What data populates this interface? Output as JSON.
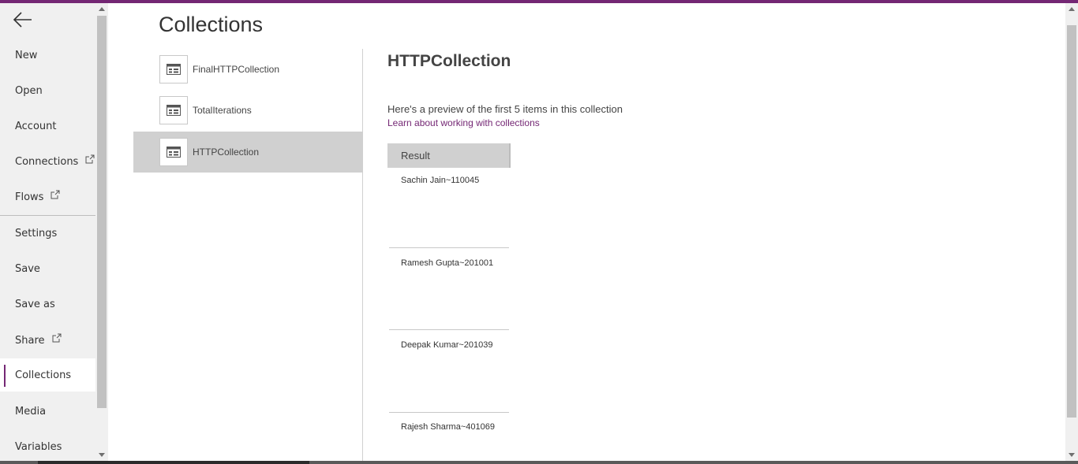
{
  "page": {
    "title": "Collections"
  },
  "sidebar": {
    "back_icon": "arrow-left-icon",
    "items": [
      {
        "label": "New",
        "external": false
      },
      {
        "label": "Open",
        "external": false
      },
      {
        "label": "Account",
        "external": false
      },
      {
        "label": "Connections",
        "external": true
      },
      {
        "label": "Flows",
        "external": true
      },
      {
        "label": "Settings",
        "external": false
      },
      {
        "label": "Save",
        "external": false
      },
      {
        "label": "Save as",
        "external": false
      },
      {
        "label": "Share",
        "external": true
      },
      {
        "label": "Collections",
        "external": false,
        "active": true
      },
      {
        "label": "Media",
        "external": false
      },
      {
        "label": "Variables",
        "external": false
      }
    ]
  },
  "collections": {
    "items": [
      {
        "label": "FinalHTTPCollection",
        "icon": "table-icon"
      },
      {
        "label": "TotalIterations",
        "icon": "table-icon"
      },
      {
        "label": "HTTPCollection",
        "icon": "table-icon",
        "selected": true
      }
    ]
  },
  "detail": {
    "title": "HTTPCollection",
    "preview_text": "Here's a preview of the first 5 items in this collection",
    "learn_link": "Learn about working with collections",
    "table": {
      "header": "Result",
      "rows": [
        "Sachin Jain~110045",
        "Ramesh Gupta~201001",
        "Deepak Kumar~201039",
        "Rajesh Sharma~401069"
      ]
    }
  },
  "colors": {
    "accent": "#742774",
    "sidebar_bg": "#f0f0f0",
    "selected_bg": "#d0d0d0"
  }
}
